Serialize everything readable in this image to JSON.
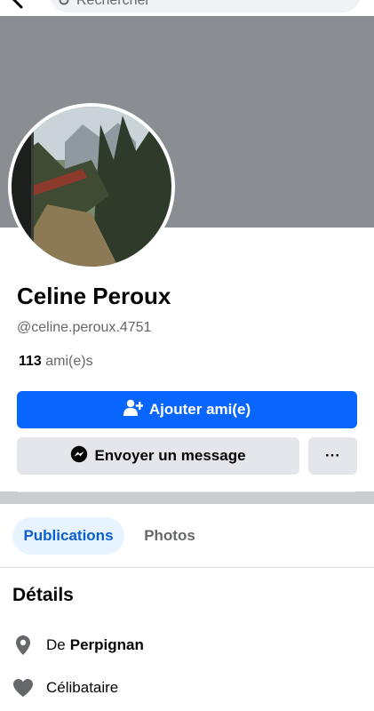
{
  "header": {
    "search_placeholder": "Rechercher"
  },
  "profile": {
    "name": "Celine Peroux",
    "handle": "@celine.peroux.4751",
    "friends_count": "113",
    "friends_label": "ami(e)s"
  },
  "actions": {
    "add_friend_label": "Ajouter ami(e)",
    "message_label": "Envoyer un message",
    "more_label": "···"
  },
  "tabs": [
    {
      "label": "Publications",
      "active": true
    },
    {
      "label": "Photos",
      "active": false
    }
  ],
  "details": {
    "title": "Détails",
    "city_prefix": "De",
    "city": "Perpignan",
    "relationship": "Célibataire"
  },
  "colors": {
    "primary": "#0866ff",
    "cover": "#8a8d91",
    "secondary_button": "#e4e6eb",
    "active_tab_bg": "#e7f3ff",
    "active_tab_text": "#0a5fd0"
  },
  "icons": {
    "back": "arrow-left-icon",
    "search": "search-icon",
    "add_friend": "person-plus-icon",
    "message": "messenger-icon",
    "more": "more-dots-icon",
    "city": "location-pin-icon",
    "relationship": "heart-icon"
  }
}
